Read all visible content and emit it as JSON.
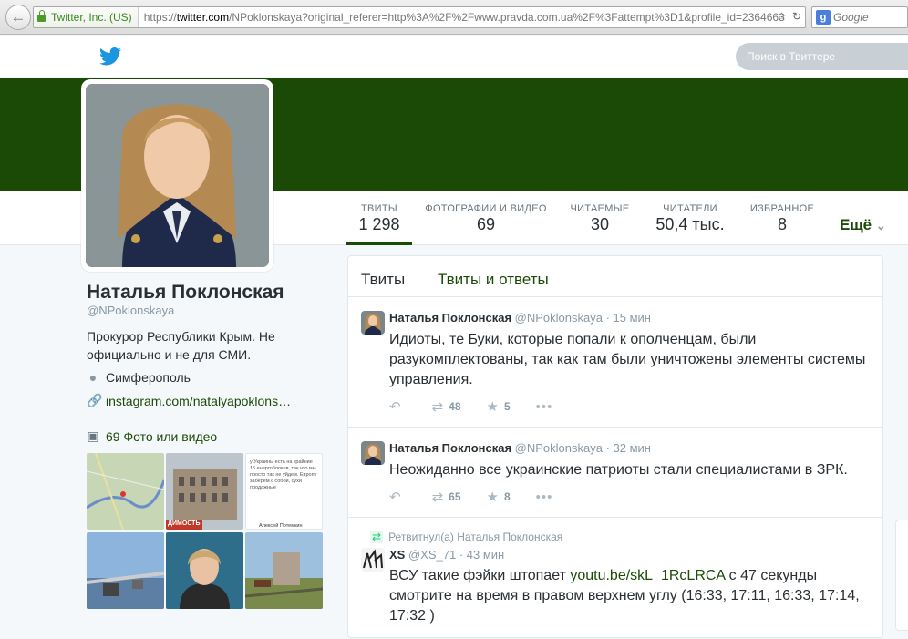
{
  "browser": {
    "site_identity": "Twitter, Inc. (US)",
    "url_prefix": "https://",
    "url_domain": "twitter.com",
    "url_rest": "/NPoklonskaya?original_referer=http%3A%2F%2Fwww.pravda.com.ua%2F%3Fattempt%3D1&profile_id=2364663",
    "search_placeholder": "Google"
  },
  "topnav": {
    "search_placeholder": "Поиск в Твиттере"
  },
  "colors": {
    "theme": "#1b4a07",
    "banner": "#1b4a07"
  },
  "stats": [
    {
      "label": "ТВИТЫ",
      "value": "1 298"
    },
    {
      "label": "ФОТОГРАФИИ И ВИДЕО",
      "value": "69"
    },
    {
      "label": "ЧИТАЕМЫЕ",
      "value": "30"
    },
    {
      "label": "ЧИТАТЕЛИ",
      "value": "50,4 тыс."
    },
    {
      "label": "ИЗБРАННОЕ",
      "value": "8"
    }
  ],
  "more_label": "Ещё",
  "profile": {
    "name": "Наталья Поклонская",
    "handle": "@NPoklonskaya",
    "bio": "Прокурор Республики Крым. Не официально и не для СМИ.",
    "location": "Симферополь",
    "website": "instagram.com/natalyapoklons…",
    "photos_label": "69 Фото или видео"
  },
  "thumb_texts": {
    "t2_caption": "ДИМОСТЬ",
    "t3_text": "у Украины есть на крайние 15 енергоблоков, так что мы просто так не уйдем. Европу заберем с собой, сухи продажные",
    "t3_author": "Алексей Потемкин"
  },
  "timeline": {
    "tab_tweets": "Твиты",
    "tab_replies": "Твиты и ответы",
    "tweets": [
      {
        "name": "Наталья Поклонская",
        "handle": "@NPoklonskaya",
        "time": "· 15 мин",
        "text": "Идиоты, те Буки, которые попали к ополченцам, были разукомплектованы, так как там были уничтожены элементы системы управления.",
        "retweets": "48",
        "favorites": "5"
      },
      {
        "name": "Наталья Поклонская",
        "handle": "@NPoklonskaya",
        "time": "· 32 мин",
        "text": "Неожиданно все украинские патриоты стали специалистами в ЗРК.",
        "retweets": "65",
        "favorites": "8"
      },
      {
        "retweet_note": "Ретвитнул(а) Наталья Поклонская",
        "name": "XS",
        "handle": "@XS_71",
        "time": "· 43 мин",
        "text_before": "ВСУ такие фэйки штопает ",
        "link": "youtu.be/skL_1RcLRCA",
        "text_after": " с 47 секунды смотрите на время в правом верхнем углу (16:33, 17:11, 16:33, 17:14, 17:32 )"
      }
    ]
  },
  "icons": {
    "back": "back-arrow-icon",
    "lock": "lock-icon",
    "bird": "twitter-bird-icon",
    "location": "map-pin-icon",
    "link": "link-icon",
    "camera": "camera-icon",
    "reply": "reply-icon",
    "retweet": "retweet-icon",
    "favorite": "star-icon",
    "more": "more-dots-icon",
    "chevron": "chevron-down-icon"
  }
}
